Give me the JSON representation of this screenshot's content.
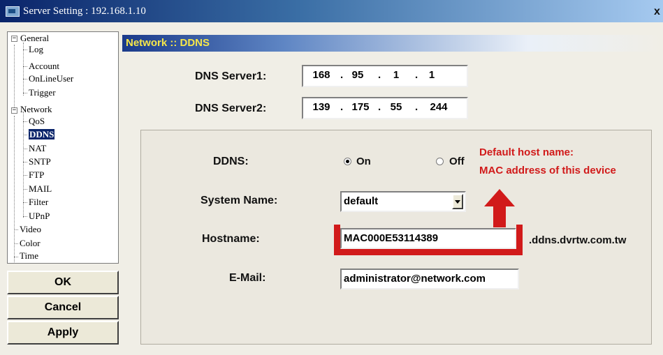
{
  "window": {
    "title": "Server Setting : 192.168.1.10",
    "close_label": "x"
  },
  "tree": {
    "general": "General",
    "general_items": [
      "Log",
      "Account",
      "OnLineUser",
      "Trigger"
    ],
    "network": "Network",
    "network_items": [
      "QoS",
      "DDNS",
      "NAT",
      "SNTP",
      "FTP",
      "MAIL",
      "Filter",
      "UPnP"
    ],
    "other_items": [
      "Video",
      "Color",
      "Time"
    ],
    "selected": "DDNS"
  },
  "buttons": {
    "ok": "OK",
    "cancel": "Cancel",
    "apply": "Apply"
  },
  "header": {
    "title": "Network :: DDNS"
  },
  "dns": {
    "server1_label": "DNS Server1:",
    "server1": [
      "168",
      "95",
      "1",
      "1"
    ],
    "server2_label": "DNS Server2:",
    "server2": [
      "139",
      "175",
      "55",
      "244"
    ]
  },
  "ddns": {
    "label": "DDNS:",
    "on_label": "On",
    "off_label": "Off",
    "selected": "On",
    "system_name_label": "System Name:",
    "system_name": "default",
    "hostname_label": "Hostname:",
    "hostname": "MAC000E53114389",
    "hostname_suffix": ".ddns.dvrtw.com.tw",
    "email_label": "E-Mail:",
    "email": "administrator@network.com"
  },
  "annotation": {
    "line1": "Default host name:",
    "line2": "MAC address of this device",
    "color": "#d11a1a"
  }
}
